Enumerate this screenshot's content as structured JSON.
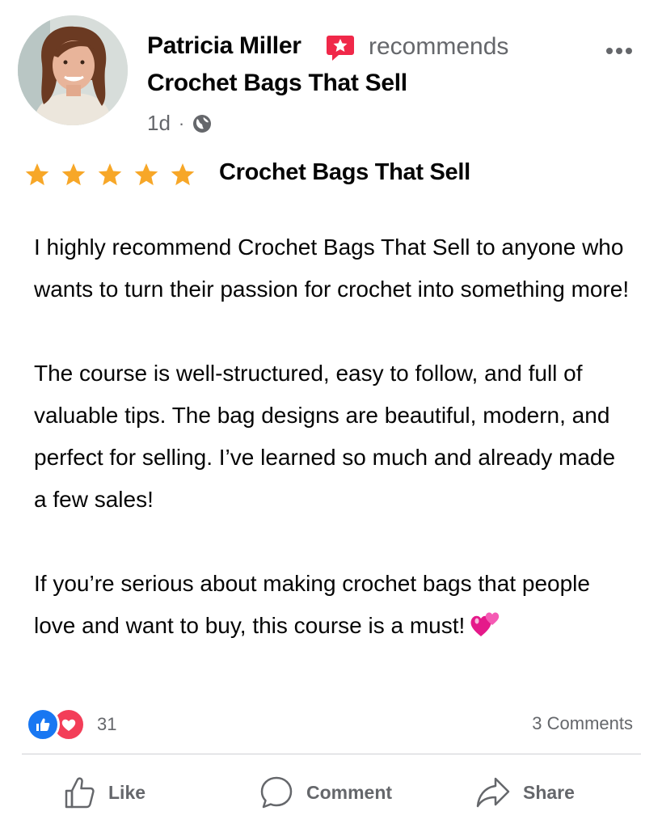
{
  "post": {
    "author": "Patricia Miller",
    "recommends_label": "recommends",
    "page_name": "Crochet Bags That Sell",
    "time": "1d",
    "separator": "·",
    "audience_icon": "globe-icon"
  },
  "review": {
    "rating": 5,
    "rating_max": 5,
    "title": "Crochet Bags That Sell",
    "paragraphs": [
      "I highly recommend Crochet Bags That Sell to anyone who wants to turn their passion for crochet into something more!",
      "The course is well-structured, easy to follow, and full of valuable tips. The bag designs are beautiful, modern, and perfect for selling. I’ve learned so much and already made a few sales!",
      "If you’re serious about making crochet bags that people love and want to buy, this course is a must!"
    ],
    "emoji": "two-hearts-emoji"
  },
  "stats": {
    "reaction_count": "31",
    "comments_label": "3 Comments"
  },
  "actions": {
    "like": "Like",
    "comment": "Comment",
    "share": "Share"
  },
  "colors": {
    "star": "#f7a728",
    "recommend_badge": "#f02849",
    "like_blue": "#1877f2",
    "love_red": "#f33e58",
    "secondary_text": "#65676b"
  }
}
